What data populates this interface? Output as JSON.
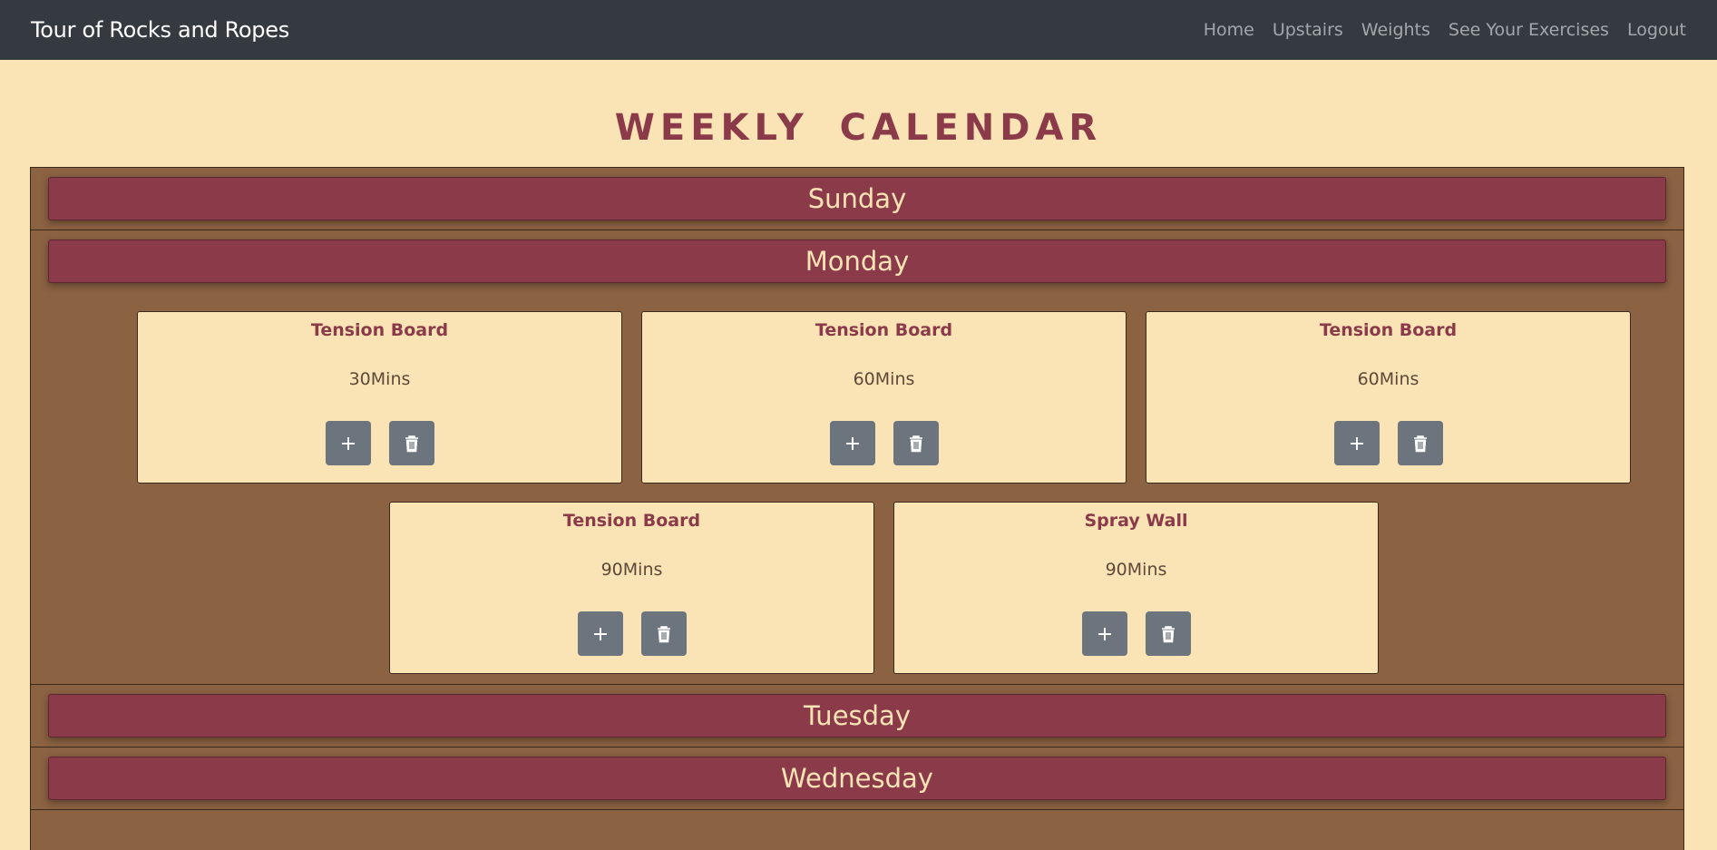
{
  "navbar": {
    "brand": "Tour of Rocks and Ropes",
    "links": [
      "Home",
      "Upstairs",
      "Weights",
      "See Your Exercises",
      "Logout"
    ]
  },
  "page_title": "WEEKLY CALENDAR",
  "days": [
    {
      "name": "Sunday",
      "exercises": []
    },
    {
      "name": "Monday",
      "exercises": [
        {
          "title": "Tension Board",
          "duration": "30Mins"
        },
        {
          "title": "Tension Board",
          "duration": "60Mins"
        },
        {
          "title": "Tension Board",
          "duration": "60Mins"
        },
        {
          "title": "Tension Board",
          "duration": "90Mins"
        },
        {
          "title": "Spray Wall",
          "duration": "90Mins"
        }
      ]
    },
    {
      "name": "Tuesday",
      "exercises": []
    },
    {
      "name": "Wednesday",
      "exercises": []
    }
  ],
  "icons": {
    "add": "plus-icon",
    "delete": "trash-icon"
  },
  "colors": {
    "background": "#fae3b4",
    "navbar": "#343a40",
    "accent": "#8b3a4a",
    "calendar_bg": "#8b6242",
    "button": "#6c757d"
  }
}
